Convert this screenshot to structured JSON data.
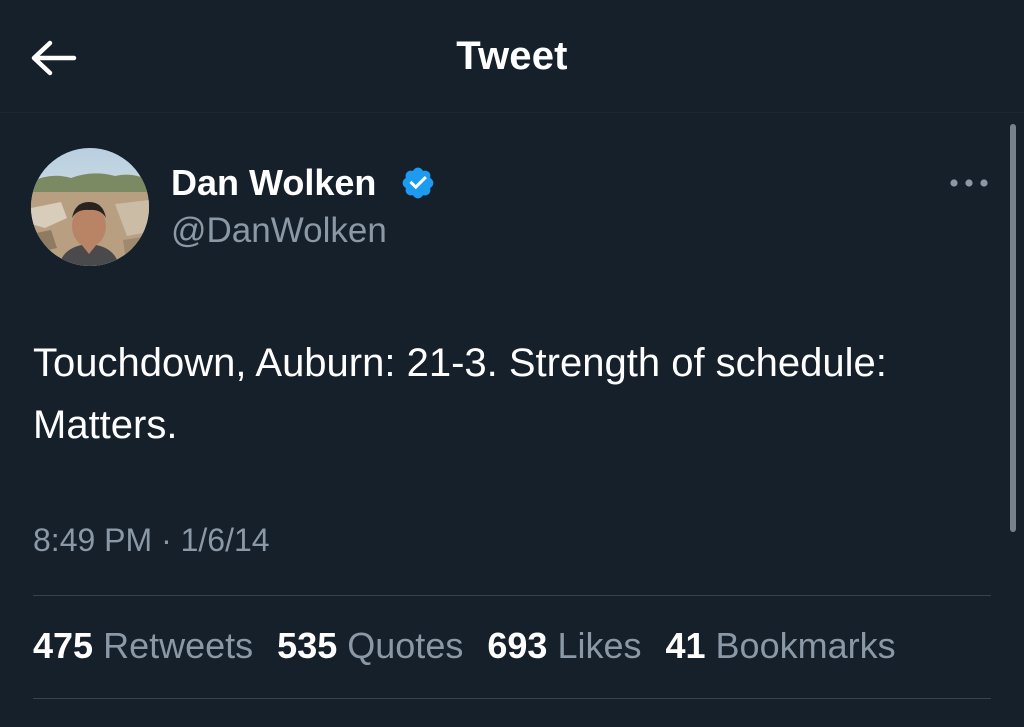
{
  "header": {
    "title": "Tweet",
    "back_icon": "arrow-left-icon"
  },
  "author": {
    "display_name": "Dan Wolken",
    "handle": "@DanWolken",
    "verified_icon": "verified-badge-icon",
    "verified_color": "#1d9bf0"
  },
  "tweet": {
    "text": "Touchdown, Auburn: 21-3. Strength of schedule: Matters.",
    "timestamp": "8:49 PM · 1/6/14"
  },
  "stats": [
    {
      "value": "475",
      "label": "Retweets"
    },
    {
      "value": "535",
      "label": "Quotes"
    },
    {
      "value": "693",
      "label": "Likes"
    },
    {
      "value": "41",
      "label": "Bookmarks"
    }
  ],
  "colors": {
    "background": "#15202b",
    "text_primary": "#ffffff",
    "text_secondary": "#8b98a5",
    "divider": "#38444d",
    "accent": "#1d9bf0"
  }
}
